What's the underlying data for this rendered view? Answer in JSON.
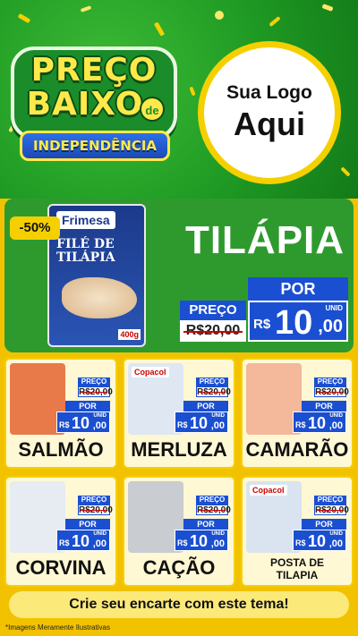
{
  "header": {
    "badge_line1": "PREÇO",
    "badge_line2": "BAIXO",
    "badge_de": "de",
    "badge_band": "INDEPENDÊNCIA",
    "logo_line1": "Sua Logo",
    "logo_line2": "Aqui"
  },
  "hero": {
    "discount": "-50%",
    "pack_brand": "Frimesa",
    "pack_name_1": "FILÉ DE",
    "pack_name_2": "TILÁPIA",
    "pack_weight": "400g",
    "title": "TILÁPIA",
    "por_label": "POR",
    "preco_label": "PREÇO",
    "old_price": "R$20,00",
    "currency": "R$",
    "price_int": "10",
    "price_dec": ",00",
    "unit": "UNID"
  },
  "products": [
    {
      "name": "SALMÃO",
      "preco_label": "PREÇO",
      "old_price": "R$20,00",
      "por_label": "POR",
      "currency": "R$",
      "price_int": "10",
      "price_dec": ",00",
      "unit": "UNID",
      "image_color": "#e87a4a"
    },
    {
      "name": "MERLUZA",
      "preco_label": "PREÇO",
      "old_price": "R$20,00",
      "por_label": "POR",
      "currency": "R$",
      "price_int": "10",
      "price_dec": ",00",
      "unit": "UNID",
      "image_color": "#dfe7f2",
      "pack_brand": "Copacol"
    },
    {
      "name": "CAMARÃO",
      "preco_label": "PREÇO",
      "old_price": "R$20,00",
      "por_label": "POR",
      "currency": "R$",
      "price_int": "10",
      "price_dec": ",00",
      "unit": "UNID",
      "image_color": "#f4b89a"
    },
    {
      "name": "CORVINA",
      "preco_label": "PREÇO",
      "old_price": "R$20,00",
      "por_label": "POR",
      "currency": "R$",
      "price_int": "10",
      "price_dec": ",00",
      "unit": "UNID",
      "image_color": "#e6ecf2"
    },
    {
      "name": "CAÇÃO",
      "preco_label": "PREÇO",
      "old_price": "R$20,00",
      "por_label": "POR",
      "currency": "R$",
      "price_int": "10",
      "price_dec": ",00",
      "unit": "UNID",
      "image_color": "#c9ccd0"
    },
    {
      "name": "POSTA DE TILAPIA",
      "preco_label": "PREÇO",
      "old_price": "R$20,00",
      "por_label": "POR",
      "currency": "R$",
      "price_int": "10",
      "price_dec": ",00",
      "unit": "UNID",
      "image_color": "#d9e4f0",
      "pack_brand": "Copacol"
    }
  ],
  "footer": {
    "cta": "Crie seu encarte com este tema!",
    "disclaimer": "*Imagens Meramente Ilustrativas"
  },
  "colors": {
    "header_green": "#1f9a24",
    "hero_green": "#2e9a2e",
    "price_blue": "#1b4fd1",
    "accent_yellow": "#f5d000",
    "background_yellow": "#f2c200"
  }
}
